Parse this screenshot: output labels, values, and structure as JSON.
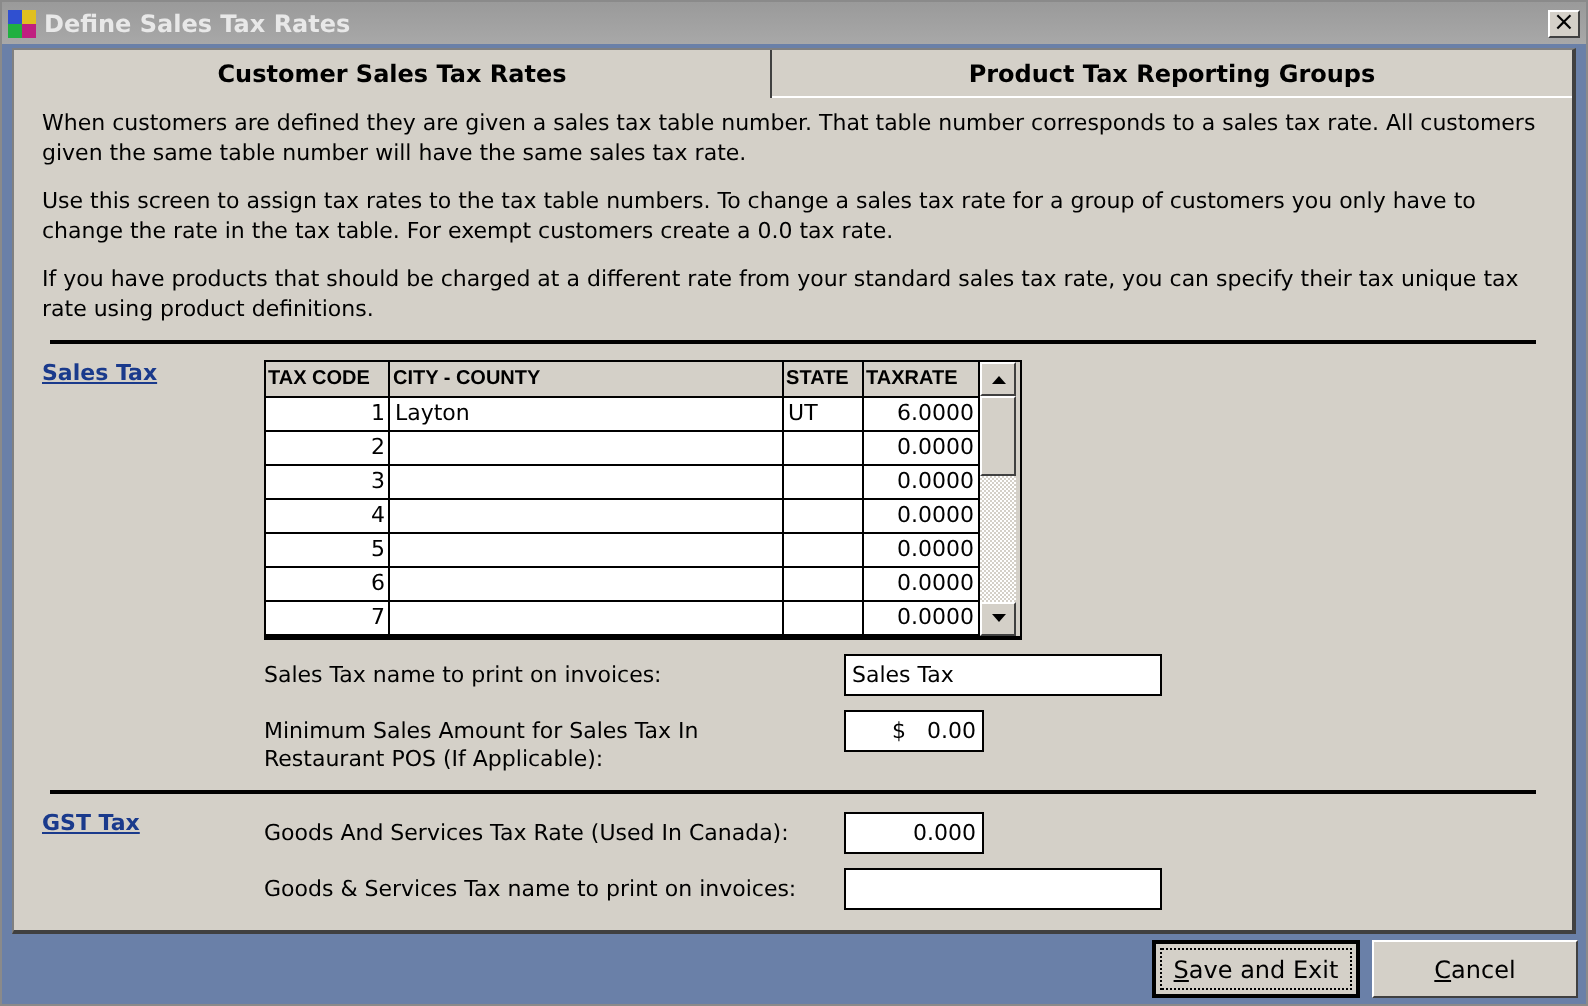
{
  "window": {
    "title": "Define Sales Tax Rates",
    "close": "×"
  },
  "tabs": [
    {
      "label": "Customer Sales Tax Rates",
      "selected": true
    },
    {
      "label": "Product Tax Reporting Groups",
      "selected": false
    }
  ],
  "paragraphs": [
    "When customers are defined they are given a sales tax table number. That table number corresponds to a sales tax rate. All customers given the same table number will have the same sales tax rate.",
    "Use this screen to assign tax rates to the tax table numbers. To change a sales tax rate for a group of customers you only have to change the rate in the tax table. For exempt customers create a 0.0 tax rate.",
    "If you have products that should be charged at a different rate from your standard sales tax rate, you can specify their tax unique tax rate using product definitions."
  ],
  "sales_tax": {
    "link": "Sales Tax",
    "table": {
      "columns": [
        "TAX CODE",
        "CITY - COUNTY",
        "STATE",
        "TAXRATE"
      ],
      "rows": [
        [
          "1",
          "Layton",
          "UT",
          "6.0000"
        ],
        [
          "2",
          "",
          "",
          "0.0000"
        ],
        [
          "3",
          "",
          "",
          "0.0000"
        ],
        [
          "4",
          "",
          "",
          "0.0000"
        ],
        [
          "5",
          "",
          "",
          "0.0000"
        ],
        [
          "6",
          "",
          "",
          "0.0000"
        ],
        [
          "7",
          "",
          "",
          "0.0000"
        ]
      ]
    },
    "fields": [
      {
        "label": "Sales Tax name to print on invoices:",
        "value": "Sales Tax",
        "kind": "wide"
      },
      {
        "label": "Minimum Sales Amount for Sales Tax In Restaurant POS (If Applicable):",
        "value": "$   0.00",
        "kind": "narrow"
      }
    ]
  },
  "gst_tax": {
    "link": "GST Tax",
    "fields": [
      {
        "label": "Goods And Services Tax Rate (Used In Canada):",
        "value": "0.000",
        "kind": "narrow"
      },
      {
        "label": "Goods & Services Tax name to print on invoices:",
        "kind": "wide"
      }
    ]
  },
  "buttons": [
    {
      "key": "S",
      "rest": "ave and Exit",
      "default": true
    },
    {
      "key": "C",
      "rest": "ancel",
      "default": false
    }
  ]
}
